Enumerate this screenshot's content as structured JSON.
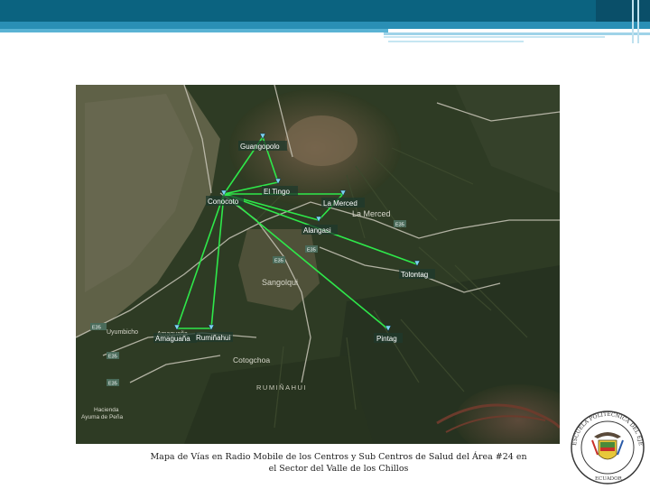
{
  "map": {
    "node_labels": {
      "guangopolo": "Guangopolo",
      "el_tingo": "El Tingo",
      "conocoto": "Conocoto",
      "la_merced_node": "La Merced",
      "alangasi": "Alangasi",
      "pintag": "Pintag",
      "amaguana": "Amaguaña",
      "rumipamba": "Rumiñahui"
    },
    "place_labels": {
      "la_merced": "La Merced",
      "sangolqui": "Sangolqui",
      "cotogchoa": "Cotogchoa",
      "ruminahui": "RUMIÑAHUI",
      "uyumbicho": "Uyumbicho",
      "amaguana": "Amaguaña",
      "hacienda": "Hacienda",
      "ayuma": "Ayuma de Peña"
    },
    "road_labels": {
      "e35_a": "E35",
      "e35_b": "E35",
      "e35_c": "E35",
      "e35_d": "E35",
      "e35_e": "E35",
      "e35_f": "E35"
    },
    "link_color": "#2ee84a",
    "node_color": "#7fd3f0"
  },
  "caption": {
    "line1": "Mapa de Vías en Radio Mobile de los Centros y Sub Centros de Salud del Área #24 en",
    "line2": "el Sector del Valle de los Chillos"
  },
  "seal": {
    "ring_text": "ESCUELA POLITECNICA DEL EJERCITO",
    "country": "ECUADOR"
  }
}
